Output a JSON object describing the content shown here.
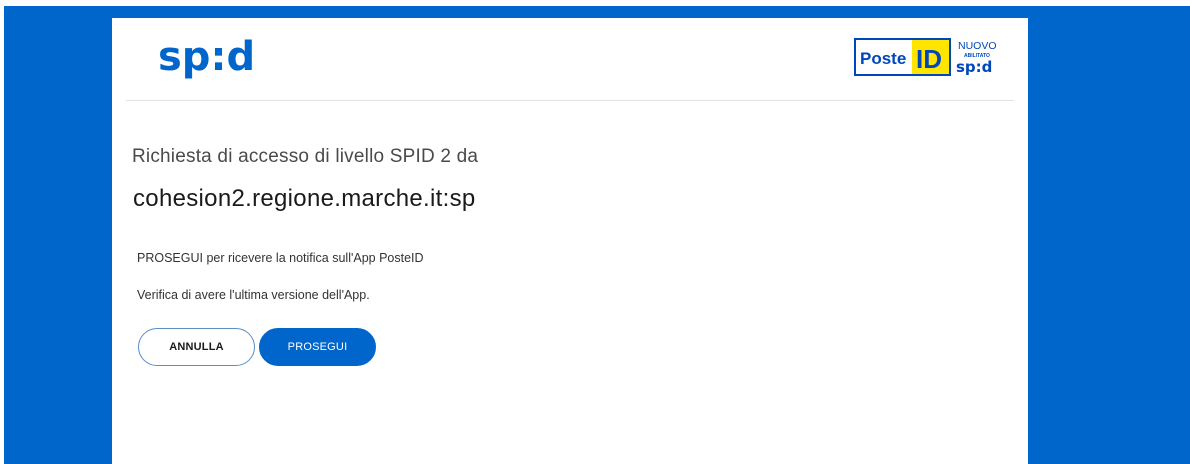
{
  "header": {
    "spid_logo_text": "sp:d",
    "poste_logo": {
      "poste": "Poste",
      "id": "ID",
      "nuovo": "NUOVO",
      "abilitato": "ABILITATO",
      "spid": "sp:d"
    }
  },
  "main": {
    "request_line": "Richiesta di accesso di livello SPID 2 da",
    "service_provider": "cohesion2.regione.marche.it:sp",
    "instruction": "PROSEGUI per ricevere la notifica sull'App PosteID",
    "version_note": "Verifica di avere l'ultima versione dell'App."
  },
  "buttons": {
    "cancel_label": "ANNULLA",
    "continue_label": "PROSEGUI"
  },
  "colors": {
    "brand_blue": "#0066cc",
    "poste_yellow": "#ffe500",
    "poste_blue": "#0047bb"
  }
}
